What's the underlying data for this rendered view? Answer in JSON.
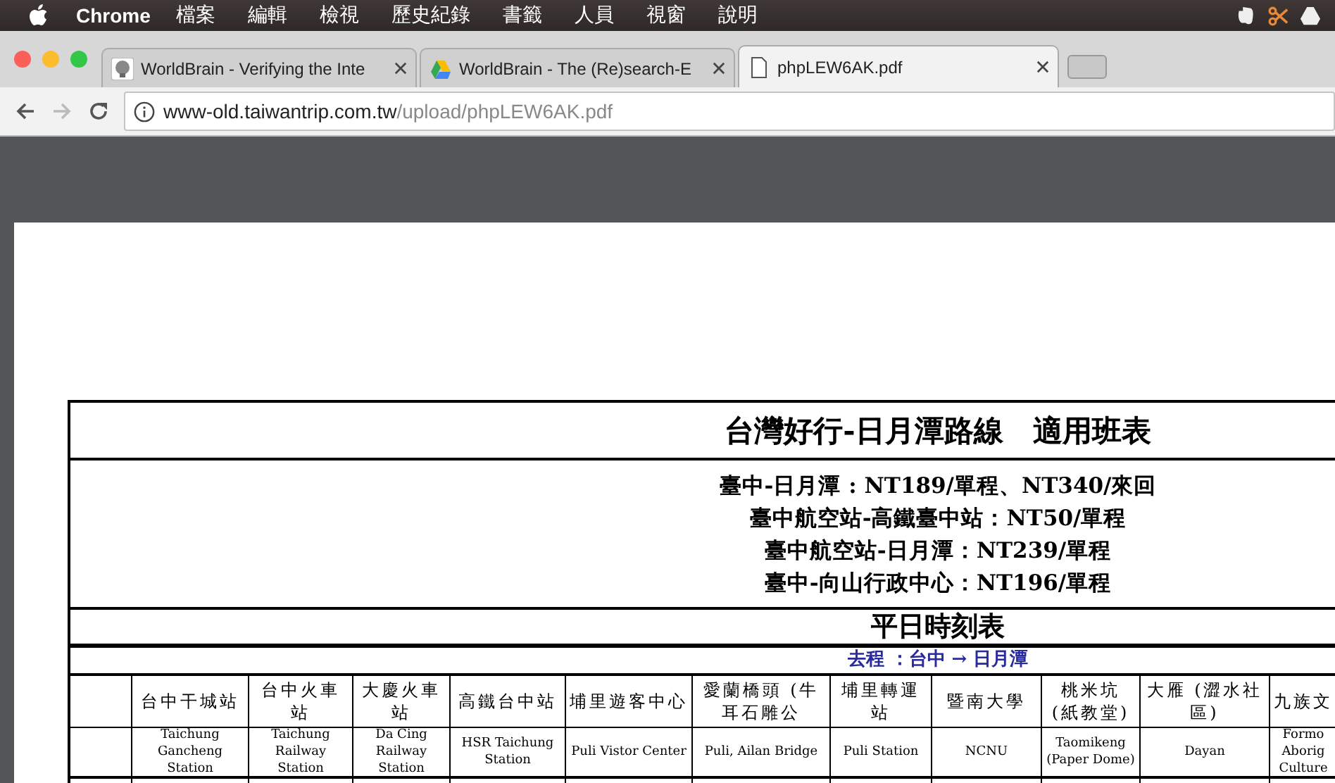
{
  "menubar": {
    "app": "Chrome",
    "menus": [
      "檔案",
      "編輯",
      "檢視",
      "歷史紀錄",
      "書籤",
      "人員",
      "視窗",
      "說明"
    ]
  },
  "tabs": [
    {
      "title": "WorldBrain - Verifying the Inte",
      "kind": "brain",
      "selected": false
    },
    {
      "title": "WorldBrain - The (Re)search-E",
      "kind": "drive",
      "selected": false
    },
    {
      "title": "phpLEW6AK.pdf",
      "kind": "page",
      "selected": true
    }
  ],
  "address": {
    "host": "www-old.taiwantrip.com.tw",
    "path": "/upload/phpLEW6AK.pdf"
  },
  "document": {
    "title": "台灣好行-日月潭路線　適用班表",
    "fares": [
      "臺中-日月潭 : NT189/單程、NT340/來回",
      "臺中航空站-高鐵臺中站：NT50/單程",
      "臺中航空站-日月潭：NT239/單程",
      "臺中-向山行政中心：NT196/單程"
    ],
    "timetable_title": "平日時刻表",
    "direction": "去程 ：台中 → 日月潭",
    "columns": [
      {
        "zh": "台中干城站",
        "en": "Taichung Gancheng Station"
      },
      {
        "zh": "台中火車站",
        "en": "Taichung Railway Station"
      },
      {
        "zh": "大慶火車站",
        "en": "Da Cing Railway Station"
      },
      {
        "zh": "高鐵台中站",
        "en": "HSR Taichung Station"
      },
      {
        "zh": "埔里遊客中心",
        "en": "Puli Vistor Center"
      },
      {
        "zh": "愛蘭橋頭 (牛耳石雕公",
        "en": "Puli, Ailan Bridge"
      },
      {
        "zh": "埔里轉運站",
        "en": "Puli Station"
      },
      {
        "zh": "暨南大學",
        "en": "NCNU"
      },
      {
        "zh": "桃米坑 (紙教堂)",
        "en": "Taomikeng (Paper Dome)"
      },
      {
        "zh": "大雁 (澀水社區)",
        "en": "Dayan"
      },
      {
        "zh": "九族文",
        "en": "Formo Aborig Culture"
      }
    ]
  }
}
